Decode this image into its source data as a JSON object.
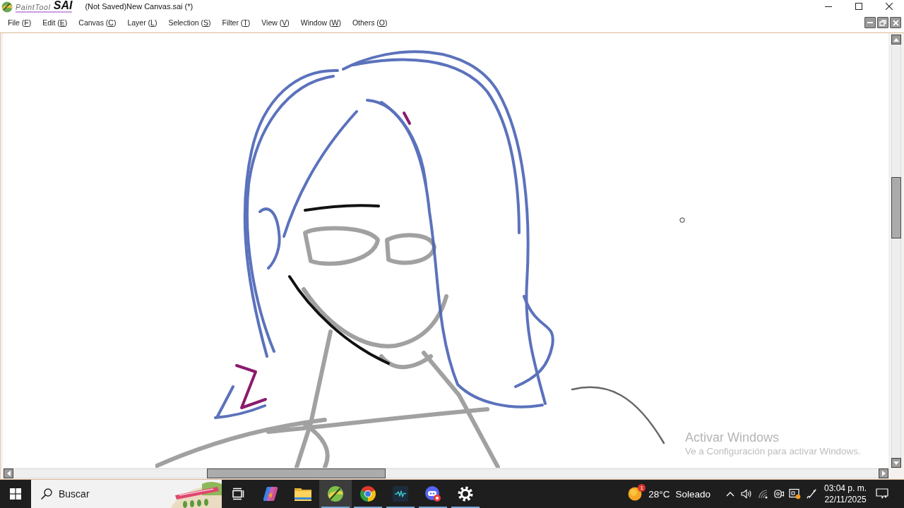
{
  "title_bar": {
    "logo": {
      "small": "PaintTool",
      "large": "SAI"
    },
    "title": "(Not Saved)New Canvas.sai (*)"
  },
  "menu": [
    {
      "text": "File (",
      "access_key": "F",
      "suffix": ")"
    },
    {
      "text": "Edit (",
      "access_key": "E",
      "suffix": ")"
    },
    {
      "text": "Canvas (",
      "access_key": "C",
      "suffix": ")"
    },
    {
      "text": "Layer (",
      "access_key": "L",
      "suffix": ")"
    },
    {
      "text": "Selection (",
      "access_key": "S",
      "suffix": ")"
    },
    {
      "text": "Filter (",
      "access_key": "T",
      "suffix": ")"
    },
    {
      "text": "View (",
      "access_key": "V",
      "suffix": ")"
    },
    {
      "text": "Window (",
      "access_key": "W",
      "suffix": ")"
    },
    {
      "text": "Others (",
      "access_key": "O",
      "suffix": ")"
    }
  ],
  "activation_notice": {
    "title": "Activar Windows",
    "message": "Ve a Configuración para activar Windows."
  },
  "taskbar": {
    "search": {
      "placeholder": "Buscar"
    },
    "apps": [
      {
        "kind": "copilot",
        "running": false,
        "selected": false
      },
      {
        "kind": "folder",
        "running": false,
        "selected": false
      },
      {
        "kind": "paint",
        "running": true,
        "selected": true
      },
      {
        "kind": "browser",
        "running": true,
        "selected": false
      },
      {
        "kind": "waveform",
        "running": true,
        "selected": false
      },
      {
        "kind": "chat",
        "running": true,
        "selected": false
      },
      {
        "kind": "settings",
        "running": true,
        "selected": false
      }
    ],
    "weather": {
      "badge": "1",
      "temperature": "28°C",
      "condition": "Soleado"
    },
    "clock": {
      "time": "03:04 p. m.",
      "date": "22/11/2025"
    }
  }
}
